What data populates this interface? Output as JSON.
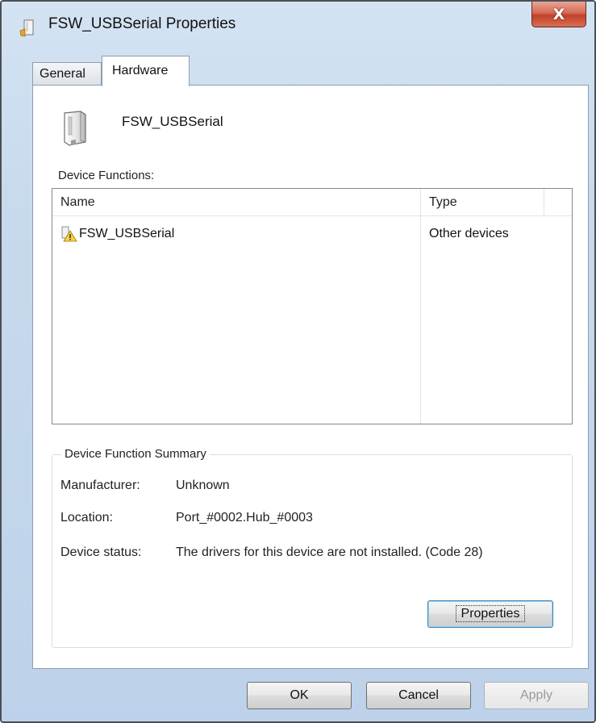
{
  "window": {
    "title": "FSW_USBSerial Properties",
    "close_glyph": "X"
  },
  "tabs": [
    {
      "label": "General",
      "selected": false
    },
    {
      "label": "Hardware",
      "selected": true
    }
  ],
  "device": {
    "name": "FSW_USBSerial",
    "icon": "usb-device-icon"
  },
  "device_functions": {
    "label": "Device Functions:",
    "columns": [
      "Name",
      "Type"
    ],
    "rows": [
      {
        "name": "FSW_USBSerial",
        "type": "Other devices",
        "icon": "warning-device-icon"
      }
    ]
  },
  "summary": {
    "title": "Device Function Summary",
    "manufacturer_label": "Manufacturer:",
    "manufacturer_value": "Unknown",
    "location_label": "Location:",
    "location_value": "Port_#0002.Hub_#0003",
    "status_label": "Device status:",
    "status_value": "The drivers for this device are not installed. (Code 28)",
    "properties_button": "Properties"
  },
  "footer": {
    "ok": "OK",
    "cancel": "Cancel",
    "apply": "Apply",
    "apply_enabled": false
  },
  "colors": {
    "frame": "#bdd2ea",
    "close_button": "#c2412a",
    "focus_border": "#3c7fb1"
  }
}
